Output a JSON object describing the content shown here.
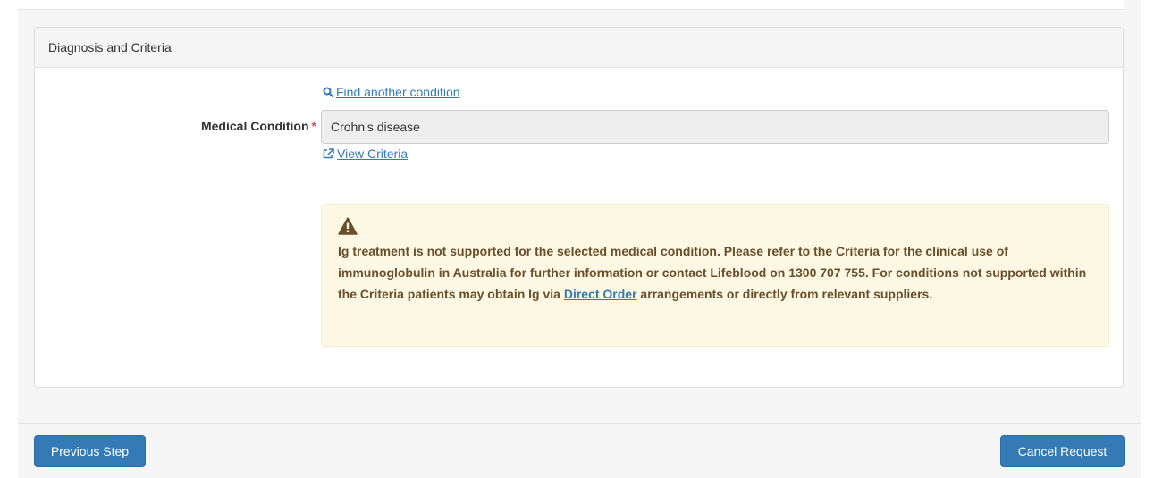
{
  "panel": {
    "heading": "Diagnosis and Criteria"
  },
  "condition": {
    "find_link": "Find another condition",
    "label": "Medical Condition",
    "required_mark": "*",
    "value": "Crohn's disease",
    "view_link": "View Criteria"
  },
  "alert": {
    "text_before": "Ig treatment is not supported for the selected medical condition. Please refer to the Criteria for the clinical use of immunoglobulin in Australia for further information or contact Lifeblood on 1300 707 755. For conditions not supported within the Criteria patients may obtain Ig via ",
    "link": "Direct Order",
    "text_after": " arrangements or directly from relevant suppliers.",
    "icon": "warning-icon"
  },
  "footer": {
    "previous_label": "Previous Step",
    "cancel_label": "Cancel Request"
  },
  "colors": {
    "primary": "#337ab7",
    "warning_bg": "#fcf8e3",
    "warning_text": "#6b4e2a",
    "required": "#d9534f"
  }
}
